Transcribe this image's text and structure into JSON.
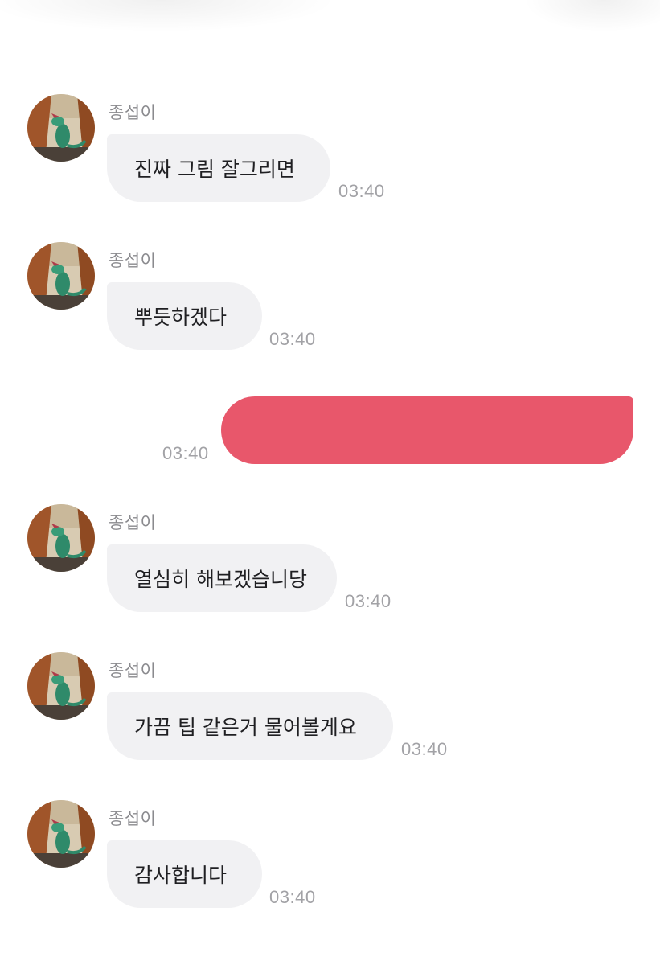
{
  "chat": {
    "colors": {
      "incoming_bubble": "#f1f1f3",
      "outgoing_bubble": "#e8576b",
      "sender_name": "#8a8a8e",
      "timestamp": "#a2a2a6"
    },
    "messages": [
      {
        "sender": "종섭이",
        "text": "진짜 그림 잘그리면",
        "time": "03:40"
      },
      {
        "sender": "종섭이",
        "text": "뿌듯하겠다",
        "time": "03:40"
      },
      {
        "sender": "me",
        "text": "",
        "time": "03:40"
      },
      {
        "sender": "종섭이",
        "text": "열심히 해보겠습니당",
        "time": "03:40"
      },
      {
        "sender": "종섭이",
        "text": "가끔 팁 같은거 물어볼게요",
        "time": "03:40"
      },
      {
        "sender": "종섭이",
        "text": "감사합니다",
        "time": "03:40"
      }
    ]
  }
}
